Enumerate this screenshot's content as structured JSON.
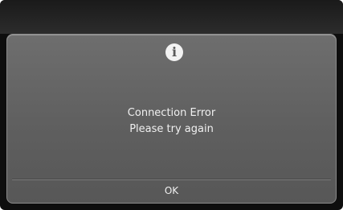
{
  "dialog": {
    "icon": "info-icon",
    "icon_glyph": "i",
    "message_line1": "Connection Error",
    "message_line2": "Please try again",
    "ok_label": "OK"
  },
  "colors": {
    "screen_background": "#0e0e0e",
    "dialog_background": "#666666",
    "text": "#f0f0f0"
  }
}
